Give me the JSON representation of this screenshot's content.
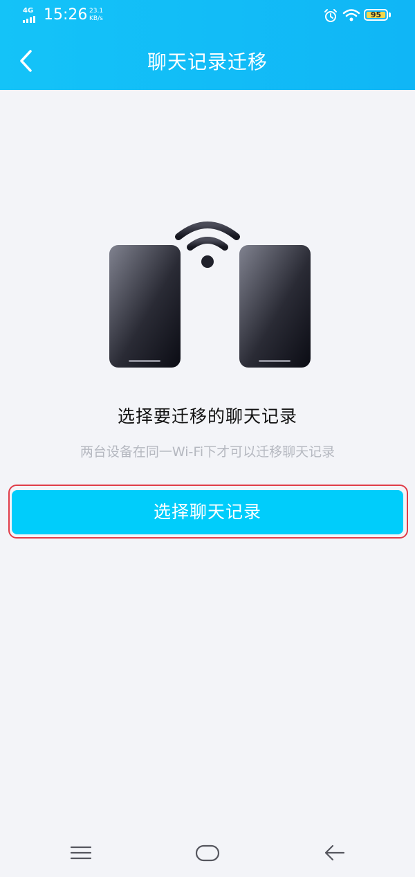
{
  "status_bar": {
    "network": "4G",
    "time": "15:26",
    "speed_value": "23.1",
    "speed_unit": "KB/s",
    "battery": "95",
    "icons": [
      "signal-icon",
      "alarm-icon",
      "wifi-icon",
      "battery-icon"
    ]
  },
  "header": {
    "title": "聊天记录迁移",
    "back_icon": "chevron-left-icon"
  },
  "main": {
    "illustration": "two-phones-wifi",
    "heading": "选择要迁移的聊天记录",
    "subtext": "两台设备在同一Wi-Fi下才可以迁移聊天记录",
    "button_label": "选择聊天记录"
  },
  "nav_bar": {
    "items": [
      "menu-icon",
      "home-icon",
      "back-arrow-icon"
    ]
  },
  "colors": {
    "header": "#14c3f8",
    "primary_button": "#00cdfb",
    "highlight_outline": "#e03c48",
    "background": "#f3f4f8"
  }
}
